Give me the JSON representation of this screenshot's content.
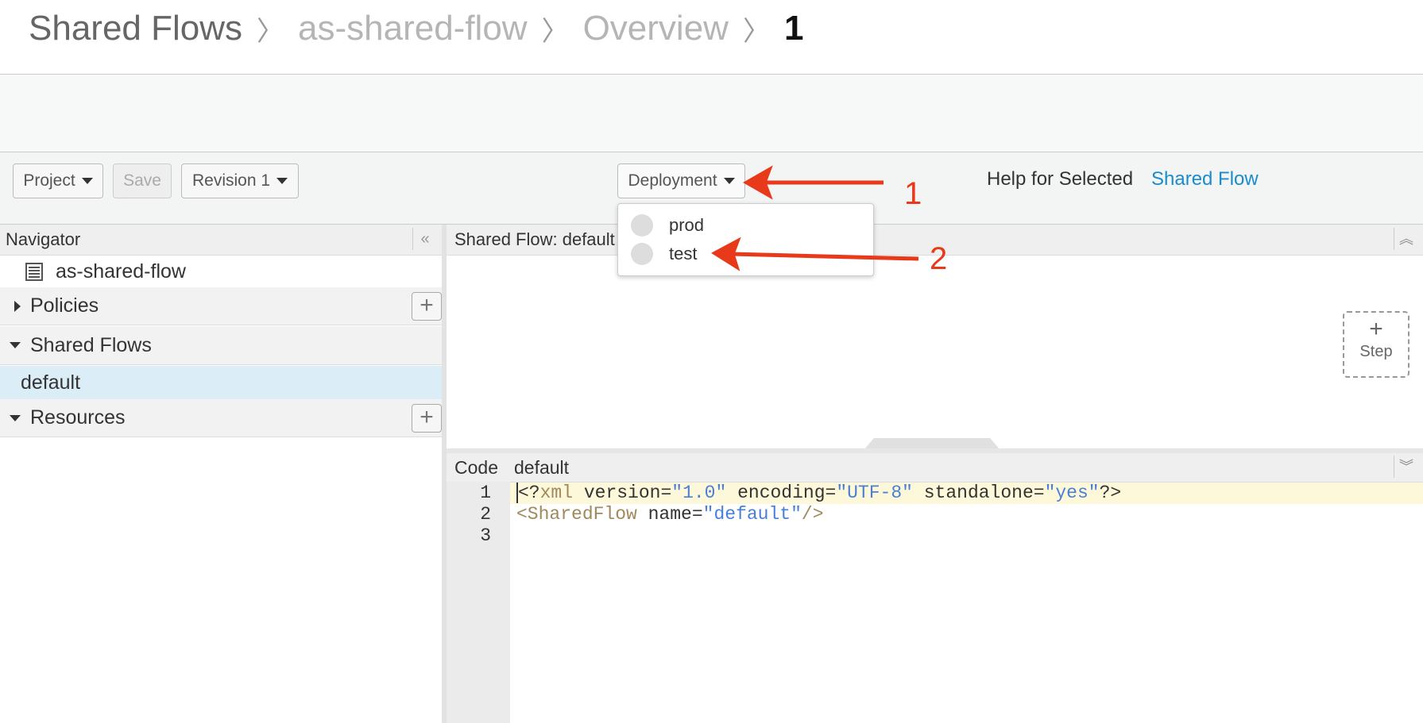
{
  "breadcrumb": [
    "Shared Flows",
    "as-shared-flow",
    "Overview",
    "1"
  ],
  "toolbar": {
    "project_label": "Project",
    "save_label": "Save",
    "revision_label": "Revision 1",
    "deployment_label": "Deployment",
    "help_text": "Help for Selected",
    "help_link": "Shared Flow"
  },
  "deployment_menu": {
    "options": [
      "prod",
      "test"
    ]
  },
  "navigator": {
    "title": "Navigator",
    "collapse_icon": "«",
    "root_item": "as-shared-flow",
    "sections": [
      "Policies",
      "Shared Flows",
      "Resources"
    ],
    "shared_flow_item": "default"
  },
  "flow_panel": {
    "title": "Shared Flow: default",
    "step_plus": "+",
    "step_label": "Step"
  },
  "code_panel": {
    "tab_code": "Code",
    "tab_file": "default",
    "line_numbers": [
      "1",
      "2",
      "3"
    ]
  },
  "annotations": [
    "1",
    "2"
  ],
  "colors": {
    "accent_link": "#1a8ccc",
    "annotation_red": "#e8391a",
    "selected_row": "#dbeef8"
  }
}
